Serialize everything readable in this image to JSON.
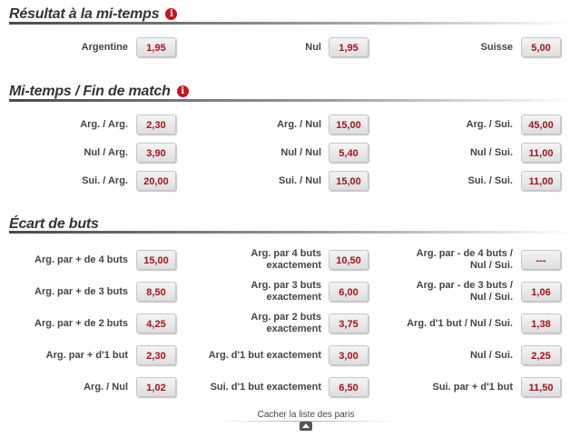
{
  "sections": {
    "halftime": {
      "title": "Résultat à la mi-temps"
    },
    "htft": {
      "title": "Mi-temps / Fin de match"
    },
    "margin": {
      "title": "Écart de buts"
    }
  },
  "halftime_result": [
    {
      "label": "Argentine",
      "odd": "1,95"
    },
    {
      "label": "Nul",
      "odd": "1,95"
    },
    {
      "label": "Suisse",
      "odd": "5,00"
    }
  ],
  "halftime_fulltime": [
    {
      "label": "Arg. / Arg.",
      "odd": "2,30"
    },
    {
      "label": "Arg. / Nul",
      "odd": "15,00"
    },
    {
      "label": "Arg. / Sui.",
      "odd": "45,00"
    },
    {
      "label": "Nul / Arg.",
      "odd": "3,90"
    },
    {
      "label": "Nul / Nul",
      "odd": "5,40"
    },
    {
      "label": "Nul / Sui.",
      "odd": "11,00"
    },
    {
      "label": "Sui. / Arg.",
      "odd": "20,00"
    },
    {
      "label": "Sui. / Nul",
      "odd": "15,00"
    },
    {
      "label": "Sui. / Sui.",
      "odd": "11,00"
    }
  ],
  "goal_margin": [
    {
      "label": "Arg. par + de 4 buts",
      "odd": "15,00"
    },
    {
      "label": "Arg. par 4 buts exactement",
      "odd": "10,50"
    },
    {
      "label": "Arg. par - de 4 buts / Nul / Sui.",
      "odd": "---"
    },
    {
      "label": "Arg. par + de 3 buts",
      "odd": "8,50"
    },
    {
      "label": "Arg. par 3 buts exactement",
      "odd": "6,00"
    },
    {
      "label": "Arg. par - de 3 buts / Nul / Sui.",
      "odd": "1,06"
    },
    {
      "label": "Arg. par + de 2 buts",
      "odd": "4,25"
    },
    {
      "label": "Arg. par 2 buts exactement",
      "odd": "3,75"
    },
    {
      "label": "Arg. d'1 but / Nul / Sui.",
      "odd": "1,38"
    },
    {
      "label": "Arg. par + d'1 but",
      "odd": "2,30"
    },
    {
      "label": "Arg. d'1 but exactement",
      "odd": "3,00"
    },
    {
      "label": "Nul / Sui.",
      "odd": "2,25"
    },
    {
      "label": "Arg. / Nul",
      "odd": "1,02"
    },
    {
      "label": "Sui. d'1 but exactement",
      "odd": "6,50"
    },
    {
      "label": "Sui. par + d'1 but",
      "odd": "11,50"
    }
  ],
  "footer": {
    "hide_label": "Cacher la liste des paris"
  },
  "colors": {
    "odd_text": "#a0141e",
    "info_icon": "#c8141e",
    "title_text": "#333333"
  },
  "icons": {
    "info": "info-icon",
    "collapse": "arrow-up-icon"
  }
}
